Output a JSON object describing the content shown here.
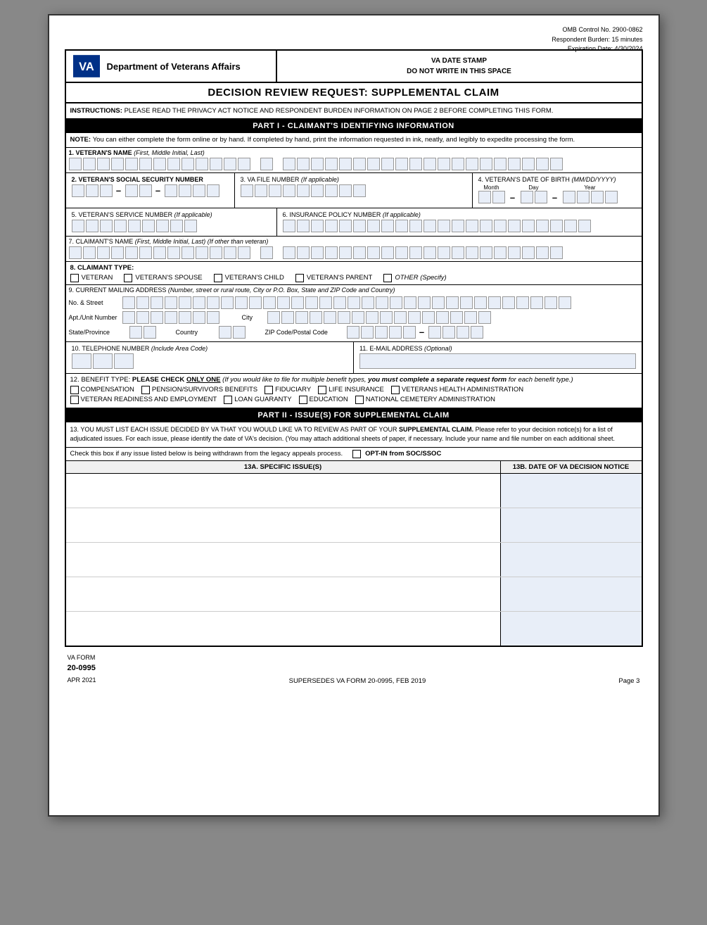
{
  "meta": {
    "omb_control": "OMB Control No. 2900-0862",
    "respondent_burden": "Respondent Burden: 15 minutes",
    "expiration_date": "Expiration Date: 4/30/2024"
  },
  "header": {
    "agency_name": "Department of Veterans Affairs",
    "date_stamp_line1": "VA DATE STAMP",
    "date_stamp_line2": "DO NOT WRITE IN THIS SPACE",
    "form_title": "DECISION REVIEW REQUEST:  SUPPLEMENTAL CLAIM"
  },
  "instructions": {
    "label": "INSTRUCTIONS: ",
    "text": "PLEASE READ THE PRIVACY ACT NOTICE AND RESPONDENT BURDEN INFORMATION ON PAGE 2 BEFORE COMPLETING THIS FORM."
  },
  "part1": {
    "header": "PART I - CLAIMANT'S IDENTIFYING INFORMATION",
    "note_label": "NOTE: ",
    "note_text": "You can either complete the form online or by hand.  If completed by hand, print the information requested in ink, neatly, and legibly to expedite processing the form.",
    "field1_label": "1. VETERAN'S NAME",
    "field1_sublabel": "(First, Middle Initial, Last)",
    "field2_label": "2. VETERAN'S SOCIAL SECURITY NUMBER",
    "field3_label": "3. VA FILE NUMBER",
    "field3_sublabel": "(If applicable)",
    "field4_label": "4. VETERAN'S DATE OF BIRTH",
    "field4_sublabel": "(MM/DD/YYYY)",
    "field4_month": "Month",
    "field4_day": "Day",
    "field4_year": "Year",
    "field5_label": "5. VETERAN'S SERVICE NUMBER",
    "field5_sublabel": "(If applicable)",
    "field6_label": "6. INSURANCE POLICY NUMBER",
    "field6_sublabel": "(If applicable)",
    "field7_label": "7. CLAIMANT'S NAME",
    "field7_sublabel": "(First, Middle Initial, Last) (If other than veteran)",
    "field8_label": "8. CLAIMANT TYPE:",
    "claimant_options": [
      {
        "id": "veteran",
        "label": "VETERAN"
      },
      {
        "id": "spouse",
        "label": "VETERAN'S SPOUSE"
      },
      {
        "id": "child",
        "label": "VETERAN'S CHILD"
      },
      {
        "id": "parent",
        "label": "VETERAN'S PARENT"
      },
      {
        "id": "other",
        "label": "OTHER (Specify)"
      }
    ],
    "field9_label": "9. CURRENT MAILING ADDRESS",
    "field9_sublabel": "(Number, street or rural route, City or P.O. Box, State and ZIP Code and Country)",
    "addr_no_street": "No. & Street",
    "addr_apt": "Apt./Unit Number",
    "addr_city": "City",
    "addr_state": "State/Province",
    "addr_country": "Country",
    "addr_zip": "ZIP Code/Postal Code",
    "field10_label": "10. TELEPHONE NUMBER",
    "field10_sublabel": "(Include Area Code)",
    "field11_label": "11. E-MAIL ADDRESS",
    "field11_sublabel": "(Optional)",
    "field12_label": "12. BENEFIT TYPE:  ",
    "field12_bold": "PLEASE CHECK ONLY ONE",
    "field12_underline": "ONLY ONE",
    "field12_italic": "(If you would like to file for multiple benefit types, you must complete a separate request form for each benefit type.)",
    "benefit_options_row1": [
      {
        "id": "compensation",
        "label": "COMPENSATION"
      },
      {
        "id": "pension",
        "label": "PENSION/SURVIVORS BENEFITS"
      },
      {
        "id": "fiduciary",
        "label": "FIDUCIARY"
      },
      {
        "id": "life_insurance",
        "label": "LIFE INSURANCE"
      },
      {
        "id": "vha",
        "label": "VETERANS HEALTH ADMINISTRATION"
      }
    ],
    "benefit_options_row2": [
      {
        "id": "vre",
        "label": "VETERAN READINESS AND EMPLOYMENT"
      },
      {
        "id": "loan",
        "label": "LOAN GUARANTY"
      },
      {
        "id": "education",
        "label": "EDUCATION"
      },
      {
        "id": "nca",
        "label": "NATIONAL CEMETERY ADMINISTRATION"
      }
    ]
  },
  "part2": {
    "header": "PART II - ISSUE(S) FOR SUPPLEMENTAL CLAIM",
    "instruction_text1": "13.  YOU MUST LIST EACH ISSUE DECIDED BY VA THAT YOU WOULD LIKE VA TO REVIEW AS PART OF YOUR ",
    "instruction_bold": "SUPPLEMENTAL CLAIM.",
    "instruction_text2": "  Please refer to your decision notice(s) for a list of adjudicated issues.  For each issue, please identify the date of VA's decision. (You may attach additional sheets of paper, if necessary. Include your name and file number on each additional sheet.",
    "opt_in_text": "Check this box if any issue listed below is being withdrawn from the legacy appeals process.",
    "opt_in_label": "OPT-IN from SOC/SSOC",
    "col_main": "13A.  SPECIFIC ISSUE(S)",
    "col_date": "13B. DATE OF VA DECISION NOTICE",
    "issue_rows": [
      {
        "id": 1
      },
      {
        "id": 2
      },
      {
        "id": 3
      },
      {
        "id": 4
      },
      {
        "id": 5
      }
    ]
  },
  "footer": {
    "form_label": "VA FORM",
    "form_number": "20-0995",
    "form_date": "APR 2021",
    "supersedes": "SUPERSEDES VA FORM 20-0995, FEB 2019",
    "page": "Page 3"
  }
}
